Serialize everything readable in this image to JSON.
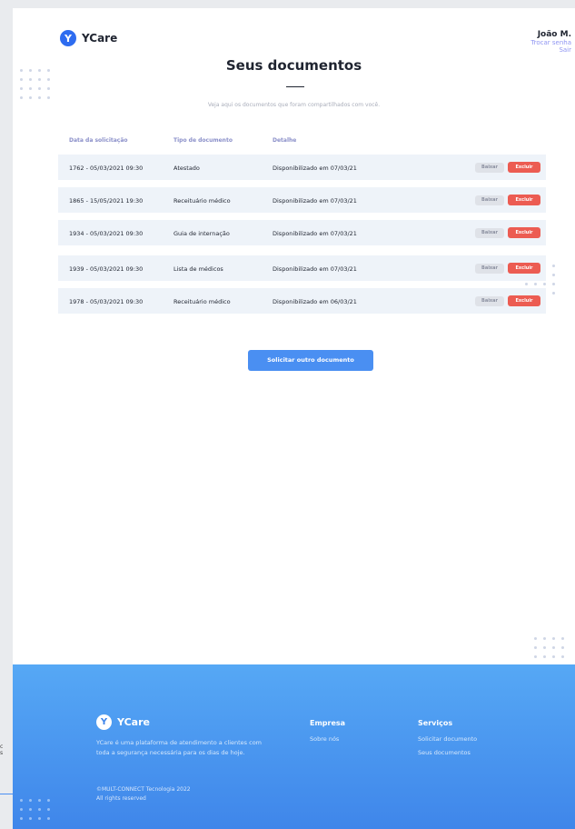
{
  "header": {
    "logo_letter": "Y",
    "logo_text": "YCare",
    "user_name": "João M.",
    "change_password": "Trocar senha",
    "logout": "Sair"
  },
  "main": {
    "title": "Seus documentos",
    "subtitle": "Veja aqui os documentos que foram compartilhados com você."
  },
  "table": {
    "headers": [
      "Data da solicitação",
      "Tipo de documento",
      "Detalhe"
    ],
    "rows": [
      {
        "date": "1762 - 05/03/2021 09:30",
        "type": "Atestado",
        "detail": "Disponibilizado em 07/03/21",
        "download": "Baixar",
        "delete": "Excluir"
      },
      {
        "date": "1865 - 15/05/2021 19:30",
        "type": "Receituário médico",
        "detail": "Disponibilizado em 07/03/21",
        "download": "Baixar",
        "delete": "Excluir"
      },
      {
        "date": "1934 - 05/03/2021 09:30",
        "type": "Guia de internação",
        "detail": "Disponibilizado em 07/03/21",
        "download": "Baixar",
        "delete": "Excluir"
      },
      {
        "date": "1939 - 05/03/2021 09:30",
        "type": "Lista de médicos",
        "detail": "Disponibilizado em 07/03/21",
        "download": "Baixar",
        "delete": "Excluir"
      },
      {
        "date": "1978 - 05/03/2021 09:30",
        "type": "Receituário médico",
        "detail": "Disponibilizado em 06/03/21",
        "download": "Baixar",
        "delete": "Excluir"
      }
    ]
  },
  "cta_label": "Solicitar outro documento",
  "footer": {
    "logo_letter": "Y",
    "logo_text": "YCare",
    "description": "YCare é uma plataforma de atendimento a clientes com toda a segurança necessária para os dias de hoje.",
    "copyright": "©MULT-CONNECT Tecnologia 2022",
    "rights": "All rights reserved",
    "company_heading": "Empresa",
    "company_link": "Sobre nós",
    "services_heading": "Serviços",
    "services_link_1": "Solicitar documento",
    "services_link_2": "Seus documentos"
  },
  "colors": {
    "brand_blue": "#2e6cf0",
    "button_blue": "#4a8ff2",
    "danger_red": "#ec5c52",
    "row_bg": "#eef3f9",
    "header_purple": "#8a8fc9"
  }
}
